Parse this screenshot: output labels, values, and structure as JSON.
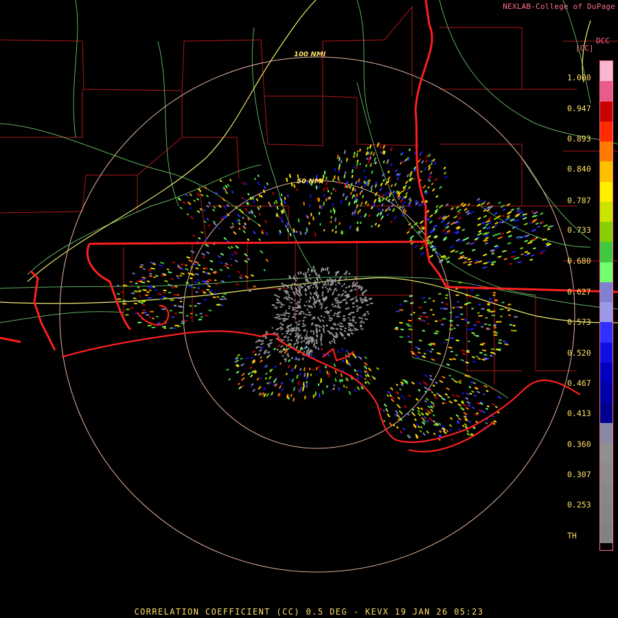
{
  "header": {
    "credit": "NEXLAB-College of DuPage",
    "station_code": "DCC",
    "unit": "[CC]"
  },
  "footer": {
    "caption": "CORRELATION COEFFICIENT (CC) 0.5 DEG - KEVX 19 JAN 26 05:23"
  },
  "range_rings": [
    "100 NMI",
    "50 NMI"
  ],
  "colorbar": {
    "labels": [
      "1.000",
      "0.947",
      "0.893",
      "0.840",
      "0.787",
      "0.733",
      "0.680",
      "0.627",
      "0.573",
      "0.520",
      "0.467",
      "0.413",
      "0.360",
      "0.307",
      "0.253",
      "TH"
    ],
    "segments": [
      "#f7b6d2",
      "#e85c8c",
      "#c80000",
      "#ff2a00",
      "#ff7a00",
      "#ffc000",
      "#fff000",
      "#c8e600",
      "#86d200",
      "#40c840",
      "#6fff6f",
      "#8080d0",
      "#9a9ae8",
      "#3030ff",
      "#1010e0",
      "#0000c0",
      "#0000a8",
      "#000090",
      "#8888a8",
      "#909090",
      "#8c8c8c",
      "#888888",
      "#858585",
      "#828282",
      "#000000"
    ]
  },
  "colors": {
    "state_border": "#ff2020",
    "county": "#b01818",
    "highway": "#f0f070",
    "road": "#70d070",
    "ring": "#e8b8a0"
  }
}
